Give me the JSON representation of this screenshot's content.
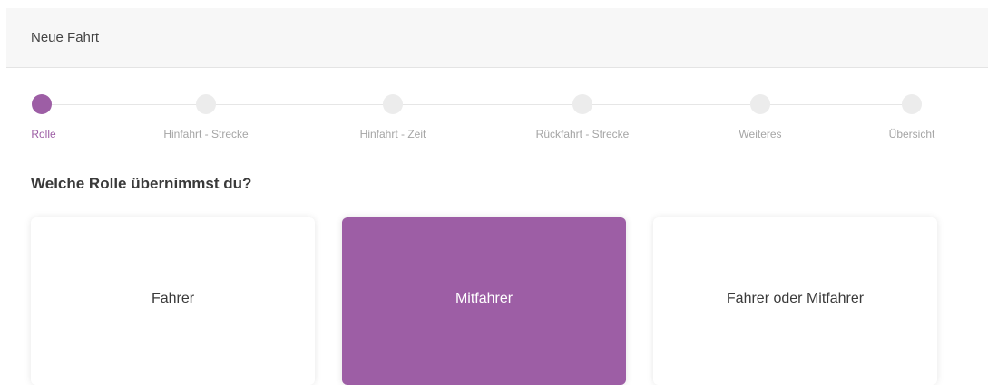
{
  "header": {
    "title": "Neue Fahrt"
  },
  "stepper": {
    "steps": [
      {
        "label": "Rolle",
        "state": "active"
      },
      {
        "label": "Hinfahrt - Strecke",
        "state": "inactive"
      },
      {
        "label": "Hinfahrt - Zeit",
        "state": "inactive"
      },
      {
        "label": "Rückfahrt - Strecke",
        "state": "inactive"
      },
      {
        "label": "Weiteres",
        "state": "inactive"
      },
      {
        "label": "Übersicht",
        "state": "inactive"
      }
    ]
  },
  "question": {
    "text": "Welche Rolle übernimmst du?"
  },
  "roles": {
    "options": [
      {
        "label": "Fahrer",
        "selected": false
      },
      {
        "label": "Mitfahrer",
        "selected": true
      },
      {
        "label": "Fahrer oder Mitfahrer",
        "selected": false
      }
    ]
  },
  "colors": {
    "accent": "#9d5ea5",
    "inactive_dot": "#ececec",
    "header_bg": "#f7f7f7"
  }
}
